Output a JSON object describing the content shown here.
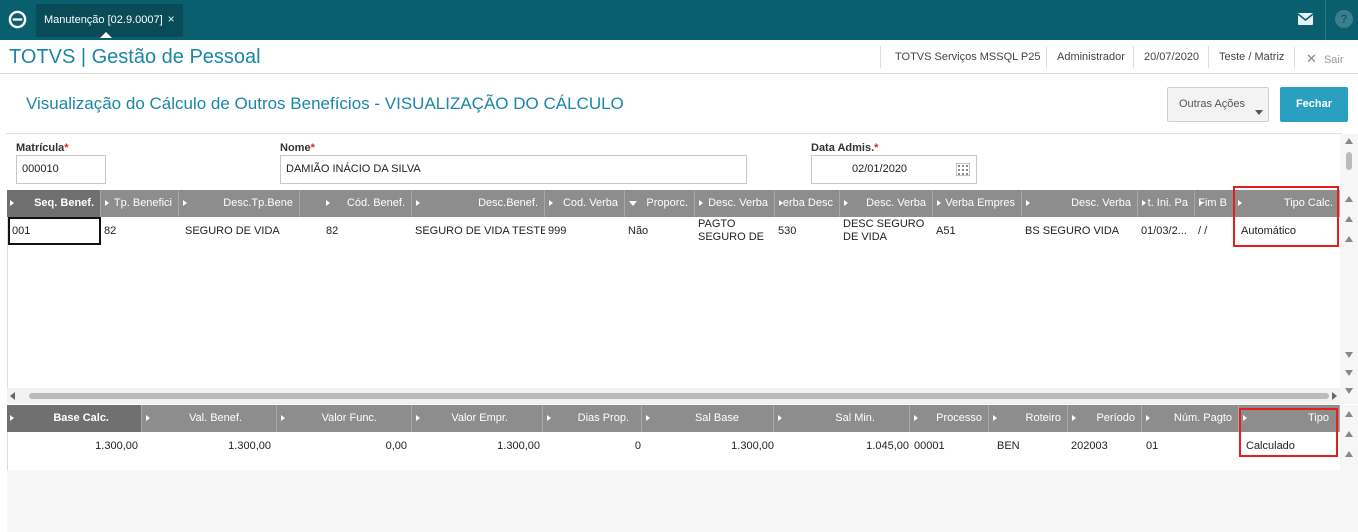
{
  "topbar": {
    "tab_label": "Manutenção [02.9.0007]",
    "tab_close": "×",
    "help_glyph": "?"
  },
  "header": {
    "app_title": "TOTVS | Gestão de Pessoal",
    "environment": "TOTVS Serviços MSSQL P25",
    "user": "Administrador",
    "date": "20/07/2020",
    "branch": "Teste / Matriz",
    "exit_label": "Sair"
  },
  "page": {
    "title": "Visualização do Cálculo de Outros Benefícios - VISUALIZAÇÃO DO CÁLCULO",
    "outras_acoes_label": "Outras Ações",
    "fechar_label": "Fechar"
  },
  "form": {
    "matricula_label": "Matrícula",
    "matricula_value": "000010",
    "nome_label": "Nome",
    "nome_value": "DAMIÃO INÁCIO DA SILVA",
    "data_admis_label": "Data Admis.",
    "data_admis_value": "02/01/2020",
    "required_mark": "*"
  },
  "grid1": {
    "headers": [
      "Seq. Benef.",
      "Tp. Benefici",
      "Desc.Tp.Bene",
      "Cód. Benef.",
      "Desc.Benef.",
      "Cod. Verba",
      "Proporc.",
      "Desc. Verba",
      "erba Desc",
      "Desc. Verba",
      "Verba Empres",
      "Desc. Verba",
      "t. Ini. Pa",
      "Fim B",
      "Tipo Calc."
    ],
    "row": [
      "001",
      "82",
      "SEGURO DE VIDA",
      "82",
      "SEGURO DE VIDA TESTE",
      "999",
      "Não",
      "PAGTO SEGURO DE ...",
      "530",
      "DESC SEGURO DE VIDA",
      "A51",
      "BS SEGURO VIDA",
      "01/03/2...",
      " /  /",
      "Automático"
    ]
  },
  "grid2": {
    "headers": [
      "Base Calc.",
      "Val. Benef.",
      "Valor Func.",
      "Valor Empr.",
      "Dias Prop.",
      "Sal Base",
      "Sal Min.",
      "Processo",
      "Roteiro",
      "Período",
      "Núm. Pagto",
      "Tipo"
    ],
    "row": [
      "1.300,00",
      "1.300,00",
      "0,00",
      "1.300,00",
      "0",
      "1.300,00",
      "1.045,00",
      "00001",
      "BEN",
      "202003",
      "01",
      "Calculado"
    ]
  },
  "colors": {
    "topbar": "#0a5f6e",
    "accent": "#1a87a8",
    "fechar": "#2aa0c0",
    "highlight": "#e41f1f"
  }
}
